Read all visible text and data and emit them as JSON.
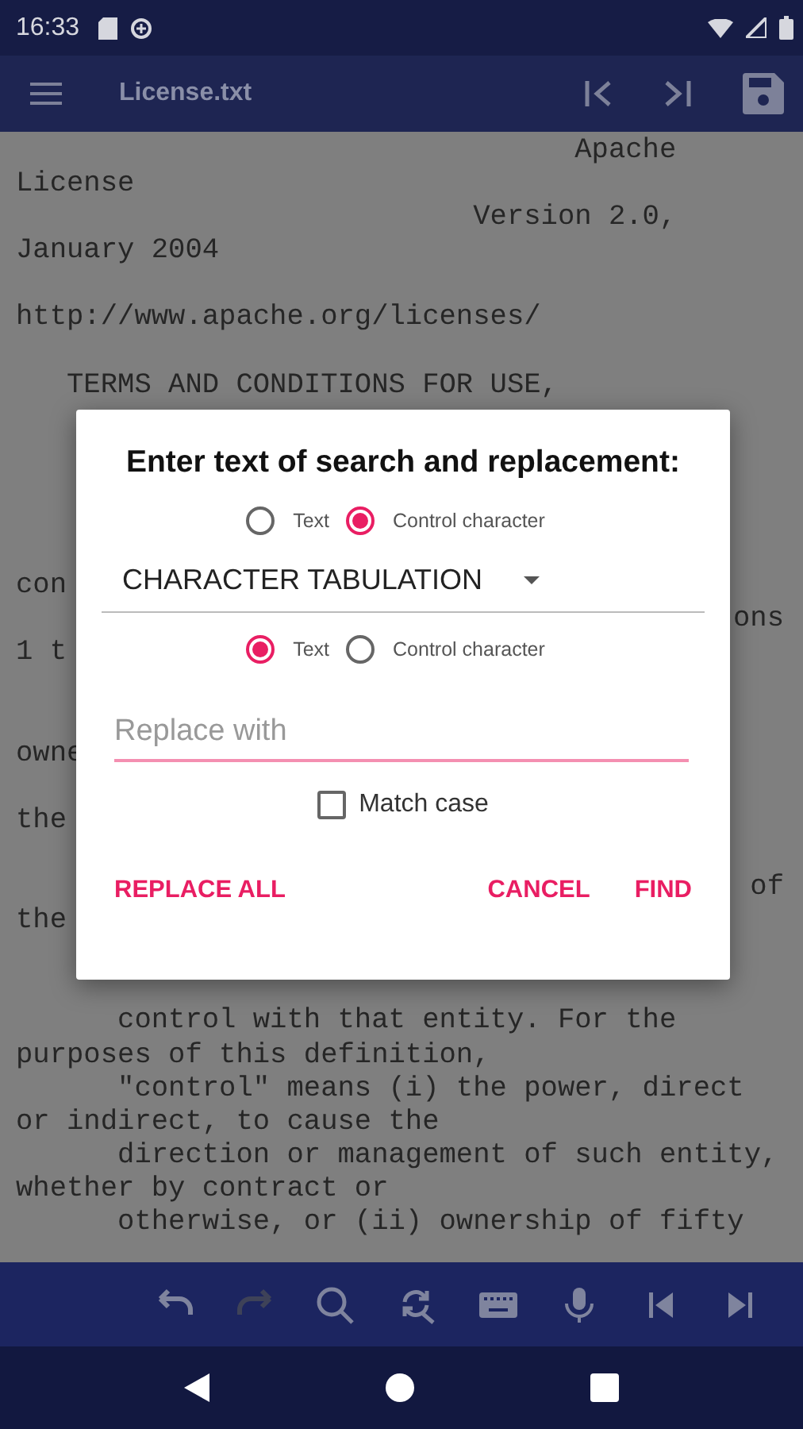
{
  "status_bar": {
    "time": "16:33"
  },
  "app_bar": {
    "title": "License.txt"
  },
  "document": {
    "lines": [
      {
        "kind": "text",
        "left": "                                 Apache"
      },
      {
        "kind": "text",
        "left": "License"
      },
      {
        "kind": "text",
        "left": "                           Version 2.0,"
      },
      {
        "kind": "text",
        "left": "January 2004"
      },
      {
        "kind": "blank"
      },
      {
        "kind": "text",
        "left": "http://www.apache.org/licenses/"
      },
      {
        "kind": "blank"
      },
      {
        "kind": "text",
        "left": "   TERMS AND CONDITIONS FOR USE,"
      },
      {
        "kind": "blank"
      },
      {
        "kind": "blank"
      },
      {
        "kind": "blank"
      },
      {
        "kind": "blank"
      },
      {
        "kind": "blank"
      },
      {
        "kind": "text",
        "left": "con"
      },
      {
        "kind": "text",
        "right": "ons"
      },
      {
        "kind": "text",
        "left": "1 t"
      },
      {
        "kind": "blank"
      },
      {
        "kind": "blank"
      },
      {
        "kind": "text",
        "left": "owne"
      },
      {
        "kind": "blank"
      },
      {
        "kind": "text",
        "left": "the"
      },
      {
        "kind": "blank"
      },
      {
        "kind": "text",
        "right": "of"
      },
      {
        "kind": "text",
        "left": "the"
      },
      {
        "kind": "blank"
      },
      {
        "kind": "blank"
      },
      {
        "kind": "text",
        "left": "      control with that entity. For the"
      },
      {
        "kind": "text",
        "left": "purposes of this definition,"
      },
      {
        "kind": "text",
        "left": "      \"control\" means (i) the power, direct"
      },
      {
        "kind": "text",
        "left": "or indirect, to cause the"
      },
      {
        "kind": "text",
        "left": "      direction or management of such entity,"
      },
      {
        "kind": "text",
        "left": "whether by contract or"
      },
      {
        "kind": "text",
        "left": "      otherwise, or (ii) ownership of fifty"
      }
    ]
  },
  "dialog": {
    "title": "Enter text of search and replacement:",
    "search_mode": [
      {
        "label": "Text",
        "selected": false
      },
      {
        "label": "Control character",
        "selected": true
      }
    ],
    "dropdown": {
      "value": "CHARACTER TABULATION"
    },
    "replace_mode": [
      {
        "label": "Text",
        "selected": true
      },
      {
        "label": "Control character",
        "selected": false
      }
    ],
    "replace_field": {
      "placeholder": "Replace with"
    },
    "match_case": {
      "label": "Match case",
      "checked": false
    },
    "buttons": [
      {
        "label": "REPLACE ALL",
        "kind": "left"
      },
      {
        "label": "CANCEL",
        "kind": "right"
      },
      {
        "label": "FIND",
        "kind": "right"
      }
    ]
  },
  "toolbar": [
    {
      "kind": "undo",
      "disabled": false
    },
    {
      "kind": "redo",
      "disabled": true
    },
    {
      "kind": "search",
      "disabled": false
    },
    {
      "kind": "replace",
      "disabled": false
    },
    {
      "kind": "keyboard",
      "disabled": false
    },
    {
      "kind": "mic",
      "disabled": false
    },
    {
      "kind": "prev",
      "disabled": false
    },
    {
      "kind": "next",
      "disabled": false
    }
  ]
}
